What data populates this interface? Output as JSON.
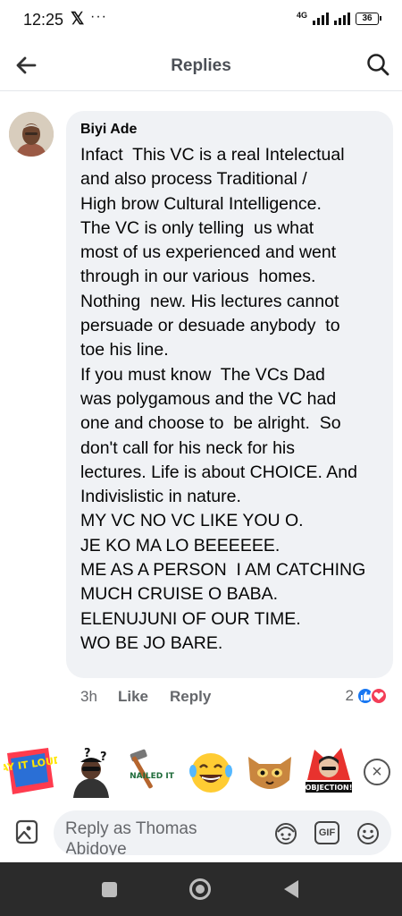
{
  "status_bar": {
    "time": "12:25",
    "x_icon": "x-logo-icon",
    "more": "···",
    "network": "4G",
    "battery": "36"
  },
  "header": {
    "title": "Replies",
    "back_icon": "arrow-left-icon",
    "search_icon": "search-icon"
  },
  "comment": {
    "author": "Biyi Ade",
    "lines": [
      "Infact  This VC is a real Intelectual",
      "and also process Traditional /",
      "High brow Cultural Intelligence.",
      "The VC is only telling  us what",
      "most of us experienced and went",
      "through in our various  homes.",
      "Nothing  new. His lectures cannot",
      "persuade or desuade anybody  to",
      "toe his line.",
      "If you must know  The VCs Dad",
      "was polygamous and the VC had",
      "one and choose to  be alright.  So",
      "don't call for his neck for his",
      "lectures. Life is about CHOICE. And",
      "Indivislistic in nature.",
      "MY VC NO VC LIKE YOU O.",
      "JE KO MA LO BEEEEEE.",
      "ME AS A PERSON  I AM CATCHING",
      "MUCH CRUISE O BABA.",
      "ELENUJUNI OF OUR TIME.",
      "WO BE JO BARE."
    ],
    "time": "3h",
    "like_label": "Like",
    "reply_label": "Reply",
    "reaction_count": "2",
    "reactions": [
      "like-reaction-icon",
      "love-reaction-icon"
    ]
  },
  "stickers": {
    "items": [
      {
        "name": "say-it-loud-sticker",
        "text": "SAY IT LOUD!"
      },
      {
        "name": "thinking-man-sticker",
        "text": "?"
      },
      {
        "name": "nailed-it-sticker",
        "text": "NAILED IT"
      },
      {
        "name": "laughing-emoji-sticker",
        "text": ""
      },
      {
        "name": "cat-sticker",
        "text": ""
      },
      {
        "name": "objection-sticker",
        "text": "OBJECTION!"
      }
    ],
    "close_icon": "close-icon"
  },
  "composer": {
    "placeholder": "Reply as Thomas Abidoye",
    "photo_icon": "photo-icon",
    "avatar_sticker_icon": "avatar-sticker-icon",
    "gif_label": "GIF",
    "emoji_icon": "emoji-icon"
  },
  "colors": {
    "accent": "#1877f2",
    "love": "#f33e58",
    "bubble": "#f0f2f5",
    "secondary_text": "#65676b"
  }
}
